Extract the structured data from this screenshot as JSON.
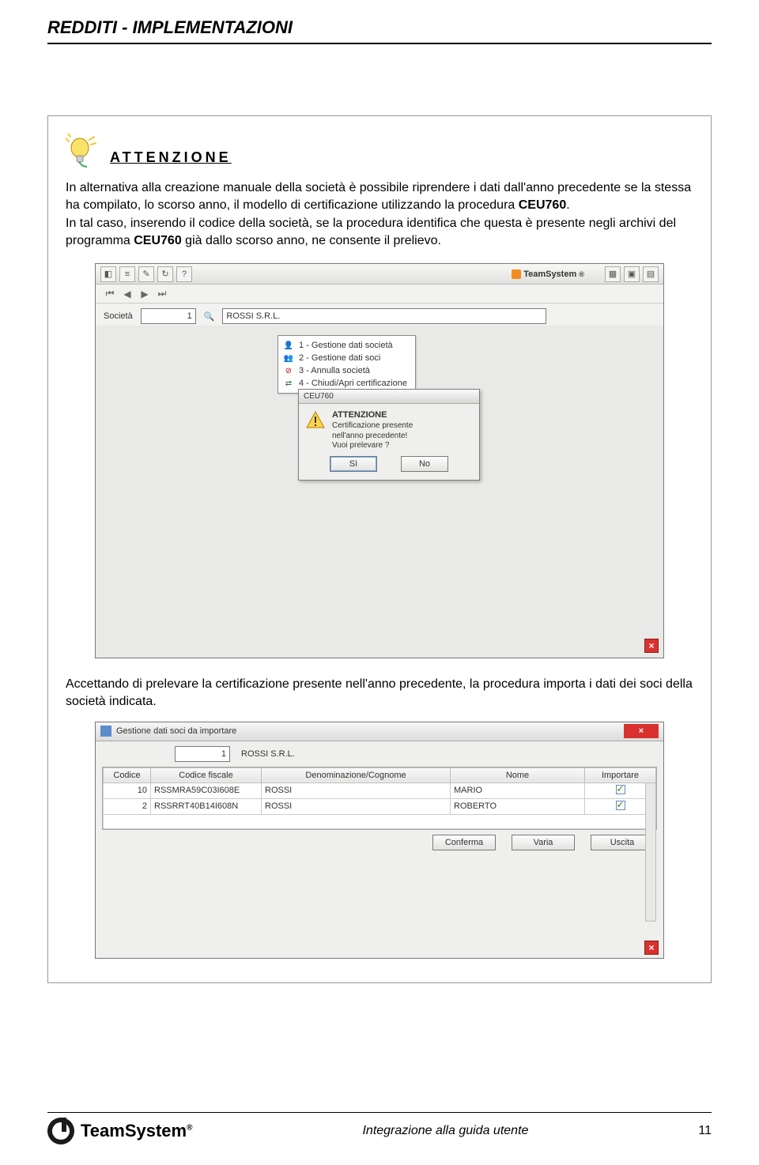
{
  "doc": {
    "title": "REDDITI - IMPLEMENTAZIONI",
    "footer_center": "Integrazione alla guida utente",
    "page_number": "11",
    "logo_text": "TeamSystem",
    "logo_reg": "®"
  },
  "callout": {
    "attn": "ATTENZIONE",
    "para1_a": "In alternativa alla creazione manuale della società è possibile riprendere i dati dall'anno precedente se la stessa ha compilato, lo scorso anno, il modello di certificazione utilizzando la procedura ",
    "para1_b": "CEU760",
    "para1_c": ".",
    "para2_a": "In tal caso, inserendo il codice della società, se la procedura identifica che questa è presente negli archivi del programma ",
    "para2_b": "CEU760",
    "para2_c": " già dallo scorso anno, ne consente il prelievo.",
    "para3": "Accettando di prelevare la certificazione presente nell'anno precedente, la procedura importa i dati dei soci della società indicata."
  },
  "shot1": {
    "brand": "TeamSystem",
    "soc_label": "Società",
    "soc_code": "1",
    "soc_name": "ROSSI S.R.L.",
    "menu": [
      "1 - Gestione dati società",
      "2 - Gestione dati soci",
      "3 - Annulla società",
      "4 - Chiudi/Apri certificazione"
    ],
    "dlg_module": "CEU760",
    "dlg_title": "ATTENZIONE",
    "dlg_line1": "Certificazione presente",
    "dlg_line2": "nell'anno precedente!",
    "dlg_line3": "Vuoi prelevare ?",
    "btn_si": "Sì",
    "btn_no": "No"
  },
  "shot2": {
    "title": "Gestione dati soci da importare",
    "soc_code": "1",
    "soc_name": "ROSSI S.R.L.",
    "cols": {
      "c1": "Codice",
      "c2": "Codice fiscale",
      "c3": "Denominazione/Cognome",
      "c4": "Nome",
      "c5": "Importare"
    },
    "rows": [
      {
        "codice": "10",
        "cf": "RSSMRA59C03I608E",
        "cogn": "ROSSI",
        "nome": "MARIO",
        "imp": true
      },
      {
        "codice": "2",
        "cf": "RSSRRT40B14I608N",
        "cogn": "ROSSI",
        "nome": "ROBERTO",
        "imp": true
      }
    ],
    "btn_conferma": "Conferma",
    "btn_varia": "Varia",
    "btn_uscita": "Uscita"
  }
}
